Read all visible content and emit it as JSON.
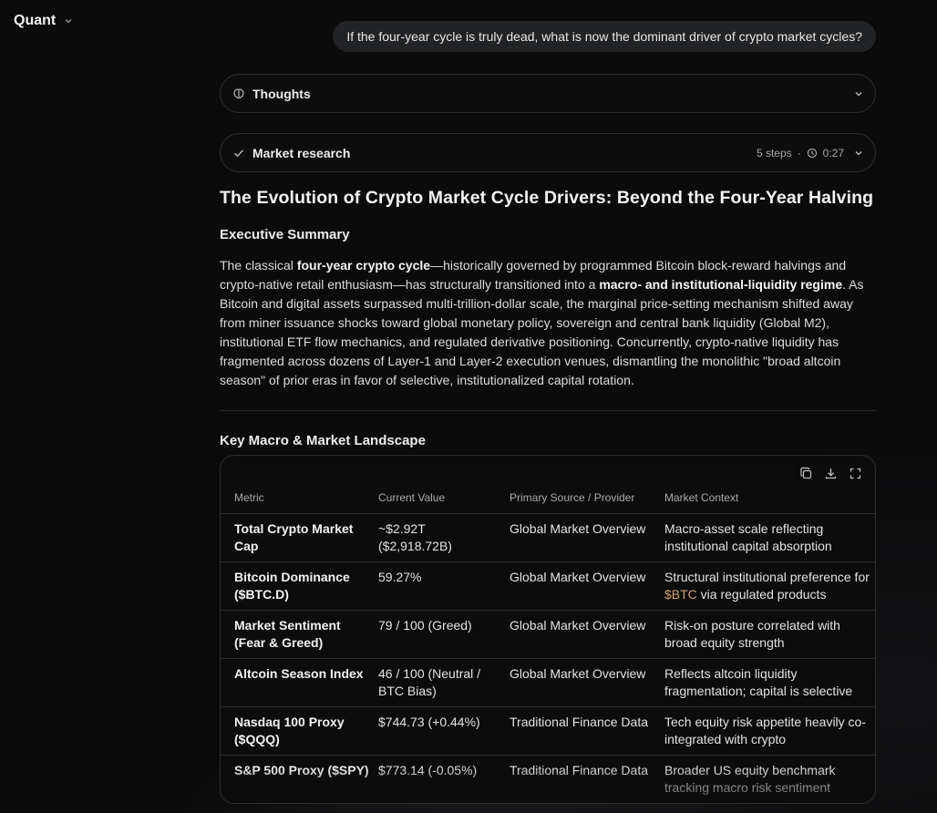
{
  "app": {
    "model_name": "Quant"
  },
  "user_message": "If the four-year cycle is truly dead, what is now the dominant driver of crypto market cycles?",
  "thoughts": {
    "label": "Thoughts"
  },
  "research": {
    "label": "Market research",
    "steps": "5 steps",
    "separator": "·",
    "duration": "0:27"
  },
  "article": {
    "title": "The Evolution of Crypto Market Cycle Drivers: Beyond the Four-Year Halving",
    "exec_heading": "Executive Summary",
    "p_1": "The classical ",
    "p_b1": "four-year crypto cycle",
    "p_2": "—historically governed by programmed Bitcoin block-reward halvings and crypto-native retail enthusiasm—has structurally transitioned into a ",
    "p_b2": "macro- and institutional-liquidity regime",
    "p_3": ". As Bitcoin and digital assets surpassed multi-trillion-dollar scale, the marginal price-setting mechanism shifted away from miner issuance shocks toward global monetary policy, sovereign and central bank liquidity (Global M2), institutional ETF flow mechanics, and regulated derivative positioning. Concurrently, crypto-native liquidity has fragmented across dozens of Layer-1 and Layer-2 execution venues, dismantling the monolithic \"broad altcoin season\" of prior eras in favor of selective, institutionalized capital rotation.",
    "landscape_heading": "Key Macro & Market Landscape"
  },
  "table": {
    "headers": [
      "Metric",
      "Current Value",
      "Primary Source / Provider",
      "Market Context"
    ],
    "rows": [
      {
        "metric": "Total Crypto Market Cap",
        "value": "~$2.92T ($2,918.72B)",
        "source": "Global Market Overview",
        "context_pre": "Macro-asset scale reflecting institutional capital absorption",
        "context_ticker": "",
        "context_post": ""
      },
      {
        "metric": "Bitcoin Dominance ($BTC.D)",
        "value": "59.27%",
        "source": "Global Market Overview",
        "context_pre": "Structural institutional preference for ",
        "context_ticker": "$BTC",
        "context_post": " via regulated products"
      },
      {
        "metric": "Market Sentiment (Fear & Greed)",
        "value": "79 / 100 (Greed)",
        "source": "Global Market Overview",
        "context_pre": "Risk-on posture correlated with broad equity strength",
        "context_ticker": "",
        "context_post": ""
      },
      {
        "metric": "Altcoin Season Index",
        "value": "46 / 100 (Neutral / BTC Bias)",
        "source": "Global Market Overview",
        "context_pre": "Reflects altcoin liquidity fragmentation; capital is selective",
        "context_ticker": "",
        "context_post": ""
      },
      {
        "metric": "Nasdaq 100 Proxy ($QQQ)",
        "value": "$744.73 (+0.44%)",
        "source": "Traditional Finance Data",
        "context_pre": "Tech equity risk appetite heavily co-integrated with crypto",
        "context_ticker": "",
        "context_post": ""
      },
      {
        "metric": "S&P 500 Proxy ($SPY)",
        "value": "$773.14 (-0.05%)",
        "source": "Traditional Finance Data",
        "context_pre": "Broader US equity benchmark tracking macro risk sentiment",
        "context_ticker": "",
        "context_post": ""
      }
    ]
  },
  "icons": {
    "model_dropdown": "chevron-down-icon",
    "thoughts": "brain-icon",
    "research_done": "check-icon",
    "clock": "clock-icon",
    "copy": "copy-icon",
    "download": "download-icon",
    "expand": "expand-icon"
  },
  "colors": {
    "ticker": "#d9a05b",
    "background": "#0b0b0c"
  }
}
